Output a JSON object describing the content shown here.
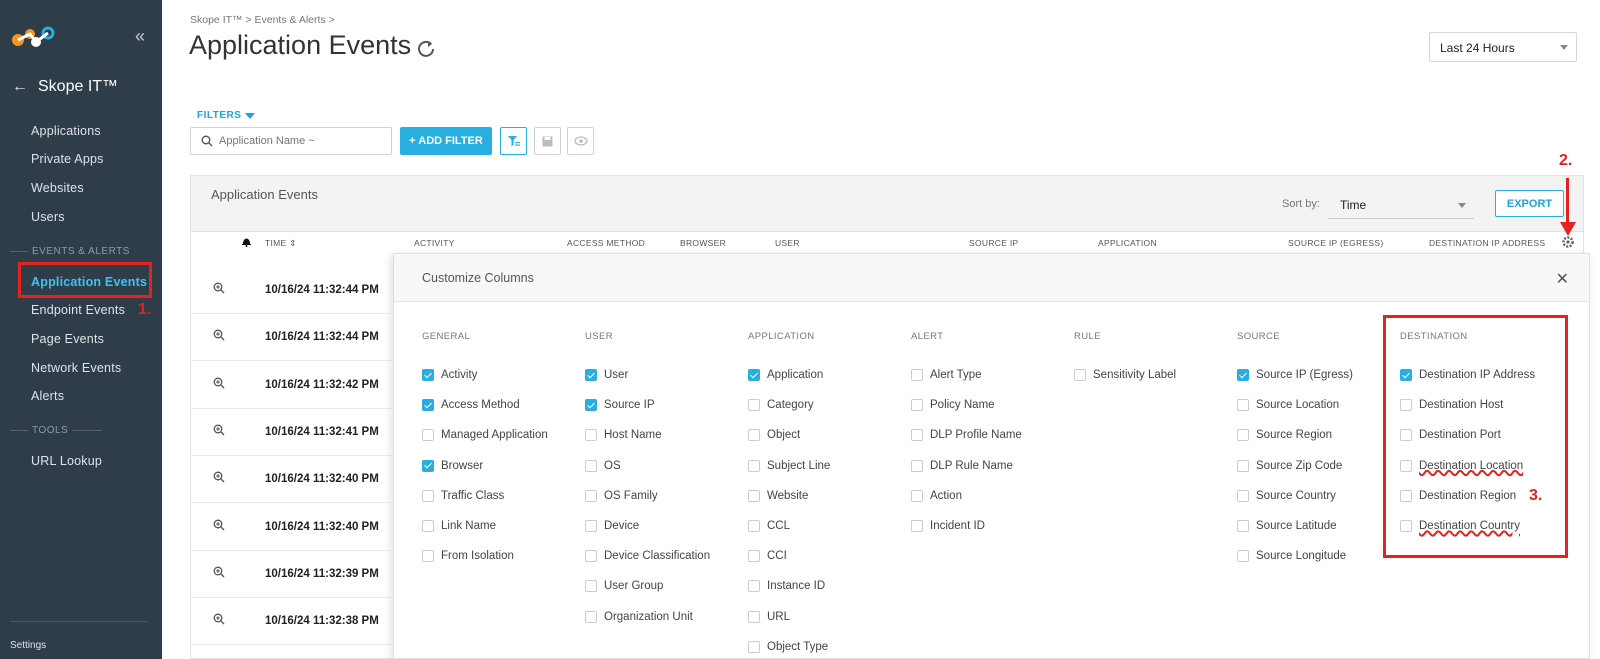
{
  "sidebar": {
    "section_title": "Skope IT™",
    "items_top": [
      "Applications",
      "Private Apps",
      "Websites",
      "Users"
    ],
    "events_header": "EVENTS & ALERTS",
    "events_items": [
      "Application Events",
      "Endpoint Events",
      "Page Events",
      "Network Events",
      "Alerts"
    ],
    "tools_header": "TOOLS",
    "tools_items": [
      "URL Lookup"
    ],
    "settings": "Settings"
  },
  "annotations": {
    "step1": "1.",
    "step2": "2.",
    "step3": "3.",
    "accent": "#e3231d"
  },
  "header": {
    "breadcrumb": "Skope IT™ > Events & Alerts >",
    "title": "Application Events",
    "time_range": "Last 24 Hours"
  },
  "filters": {
    "label": "FILTERS",
    "search_placeholder": "Application Name ~",
    "add_filter": "+ ADD FILTER"
  },
  "panel": {
    "title": "Application Events",
    "sort_label": "Sort by:",
    "sort_value": "Time",
    "export": "EXPORT",
    "columns": [
      "TIME",
      "ACTIVITY",
      "ACCESS METHOD",
      "BROWSER",
      "USER",
      "SOURCE IP",
      "APPLICATION",
      "SOURCE IP (EGRESS)",
      "DESTINATION IP ADDRESS"
    ],
    "rows": [
      "10/16/24 11:32:44 PM",
      "10/16/24 11:32:44 PM",
      "10/16/24 11:32:42 PM",
      "10/16/24 11:32:41 PM",
      "10/16/24 11:32:40 PM",
      "10/16/24 11:32:40 PM",
      "10/16/24 11:32:39 PM",
      "10/16/24 11:32:38 PM"
    ]
  },
  "modal": {
    "title": "Customize Columns",
    "groups": [
      {
        "header": "GENERAL",
        "options": [
          {
            "label": "Activity",
            "checked": true
          },
          {
            "label": "Access Method",
            "checked": true
          },
          {
            "label": "Managed Application",
            "checked": false
          },
          {
            "label": "Browser",
            "checked": true
          },
          {
            "label": "Traffic Class",
            "checked": false
          },
          {
            "label": "Link Name",
            "checked": false
          },
          {
            "label": "From Isolation",
            "checked": false
          }
        ]
      },
      {
        "header": "USER",
        "options": [
          {
            "label": "User",
            "checked": true
          },
          {
            "label": "Source IP",
            "checked": true
          },
          {
            "label": "Host Name",
            "checked": false
          },
          {
            "label": "OS",
            "checked": false
          },
          {
            "label": "OS Family",
            "checked": false
          },
          {
            "label": "Device",
            "checked": false
          },
          {
            "label": "Device Classification",
            "checked": false
          },
          {
            "label": "User Group",
            "checked": false
          },
          {
            "label": "Organization Unit",
            "checked": false
          }
        ]
      },
      {
        "header": "APPLICATION",
        "options": [
          {
            "label": "Application",
            "checked": true
          },
          {
            "label": "Category",
            "checked": false
          },
          {
            "label": "Object",
            "checked": false
          },
          {
            "label": "Subject Line",
            "checked": false
          },
          {
            "label": "Website",
            "checked": false
          },
          {
            "label": "CCL",
            "checked": false
          },
          {
            "label": "CCI",
            "checked": false
          },
          {
            "label": "Instance ID",
            "checked": false
          },
          {
            "label": "URL",
            "checked": false
          },
          {
            "label": "Object Type",
            "checked": false
          }
        ]
      },
      {
        "header": "ALERT",
        "options": [
          {
            "label": "Alert Type",
            "checked": false
          },
          {
            "label": "Policy Name",
            "checked": false
          },
          {
            "label": "DLP Profile Name",
            "checked": false
          },
          {
            "label": "DLP Rule Name",
            "checked": false
          },
          {
            "label": "Action",
            "checked": false
          },
          {
            "label": "Incident ID",
            "checked": false
          }
        ]
      },
      {
        "header": "RULE",
        "options": [
          {
            "label": "Sensitivity Label",
            "checked": false
          }
        ]
      },
      {
        "header": "SOURCE",
        "options": [
          {
            "label": "Source IP (Egress)",
            "checked": true
          },
          {
            "label": "Source Location",
            "checked": false
          },
          {
            "label": "Source Region",
            "checked": false
          },
          {
            "label": "Source Zip Code",
            "checked": false
          },
          {
            "label": "Source Country",
            "checked": false
          },
          {
            "label": "Source Latitude",
            "checked": false
          },
          {
            "label": "Source Longitude",
            "checked": false
          }
        ]
      },
      {
        "header": "DESTINATION",
        "options": [
          {
            "label": "Destination IP Address",
            "checked": true
          },
          {
            "label": "Destination Host",
            "checked": false
          },
          {
            "label": "Destination Port",
            "checked": false
          },
          {
            "label": "Destination Location",
            "checked": false,
            "underline": true
          },
          {
            "label": "Destination Region",
            "checked": false
          },
          {
            "label": "Destination Country",
            "checked": false,
            "underline": true
          }
        ]
      }
    ]
  }
}
